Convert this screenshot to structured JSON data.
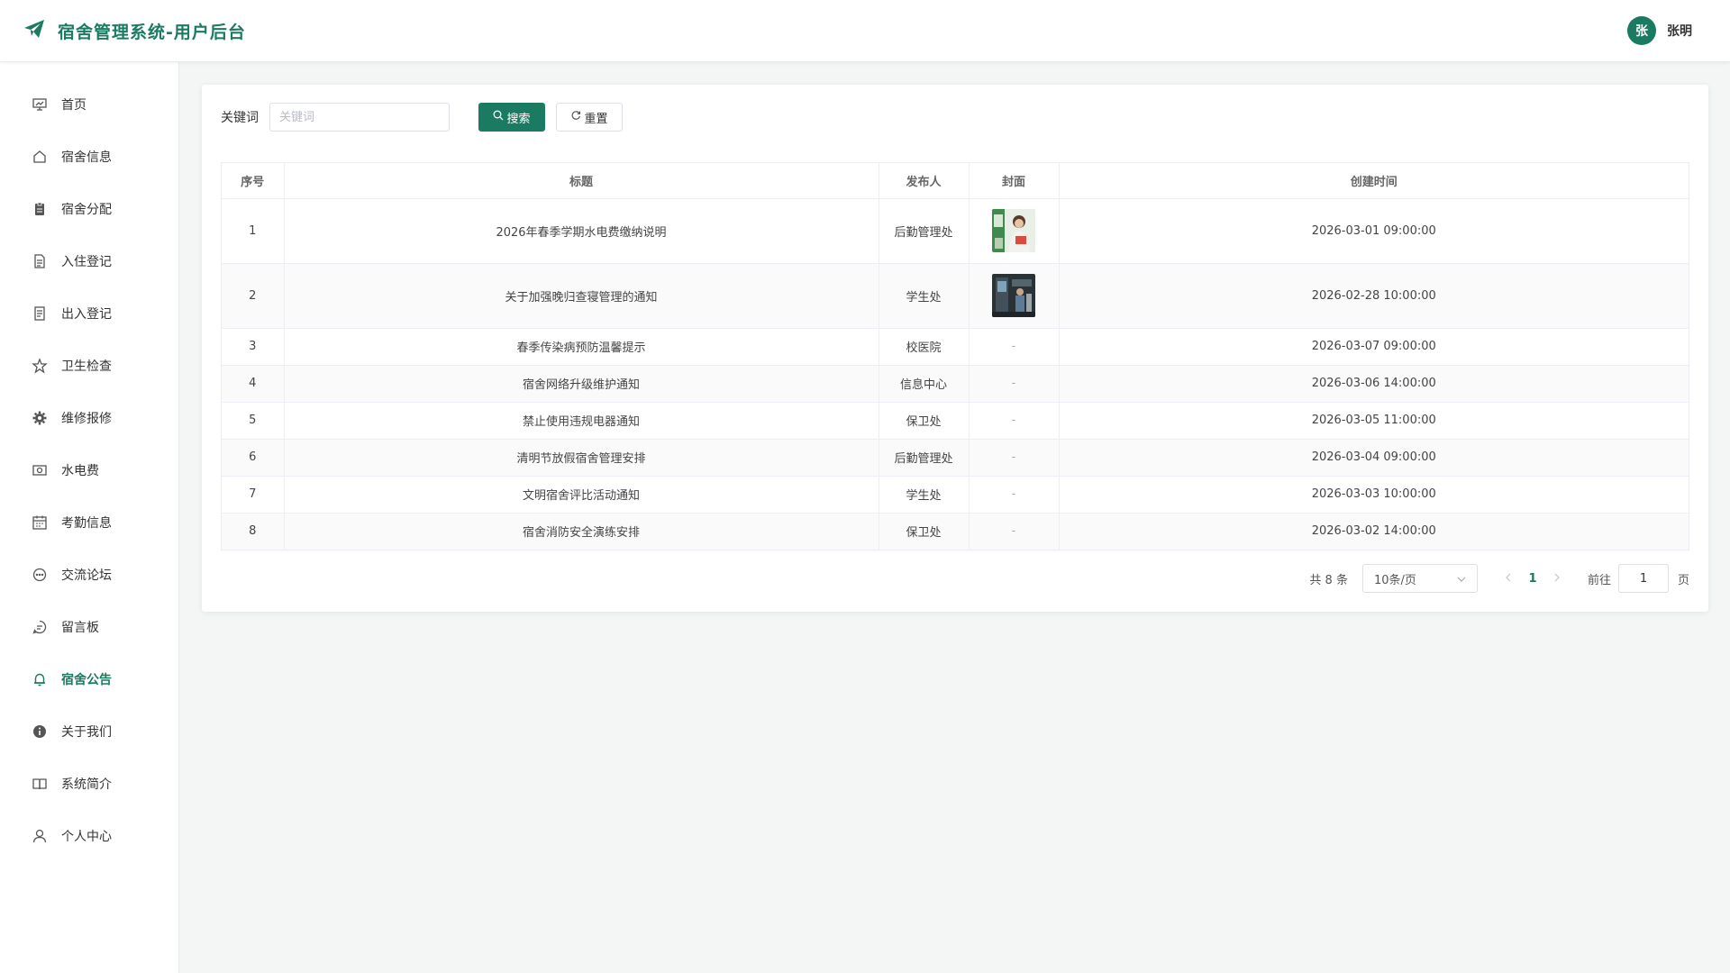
{
  "header": {
    "title": "宿舍管理系统-用户后台",
    "avatar_text": "张",
    "username": "张明",
    "accent": "#1a7a62"
  },
  "sidebar": {
    "items": [
      {
        "label": "首页",
        "icon": "dashboard-icon"
      },
      {
        "label": "宿舍信息",
        "icon": "home-icon"
      },
      {
        "label": "宿舍分配",
        "icon": "clipboard-icon"
      },
      {
        "label": "入住登记",
        "icon": "document-icon"
      },
      {
        "label": "出入登记",
        "icon": "tickets-icon"
      },
      {
        "label": "卫生检查",
        "icon": "star-icon"
      },
      {
        "label": "维修报修",
        "icon": "gear-icon"
      },
      {
        "label": "水电费",
        "icon": "money-icon"
      },
      {
        "label": "考勤信息",
        "icon": "calendar-icon"
      },
      {
        "label": "交流论坛",
        "icon": "chat-icon"
      },
      {
        "label": "留言板",
        "icon": "message-icon"
      },
      {
        "label": "宿舍公告",
        "icon": "bell-icon",
        "active": true
      },
      {
        "label": "关于我们",
        "icon": "info-icon"
      },
      {
        "label": "系统简介",
        "icon": "book-icon"
      },
      {
        "label": "个人中心",
        "icon": "user-icon"
      }
    ]
  },
  "search": {
    "label": "关键词",
    "placeholder": "关键词",
    "value": "",
    "search_label": "搜索",
    "reset_label": "重置"
  },
  "table": {
    "columns": [
      "序号",
      "标题",
      "发布人",
      "封面",
      "创建时间"
    ],
    "rows": [
      {
        "index": "1",
        "title": "2026年春季学期水电费缴纳说明",
        "publisher": "后勤管理处",
        "cover": "image",
        "created": "2026-03-01 09:00:00"
      },
      {
        "index": "2",
        "title": "关于加强晚归查寝管理的通知",
        "publisher": "学生处",
        "cover": "image",
        "created": "2026-02-28 10:00:00"
      },
      {
        "index": "3",
        "title": "春季传染病预防温馨提示",
        "publisher": "校医院",
        "cover": "-",
        "created": "2026-03-07 09:00:00"
      },
      {
        "index": "4",
        "title": "宿舍网络升级维护通知",
        "publisher": "信息中心",
        "cover": "-",
        "created": "2026-03-06 14:00:00"
      },
      {
        "index": "5",
        "title": "禁止使用违规电器通知",
        "publisher": "保卫处",
        "cover": "-",
        "created": "2026-03-05 11:00:00"
      },
      {
        "index": "6",
        "title": "清明节放假宿舍管理安排",
        "publisher": "后勤管理处",
        "cover": "-",
        "created": "2026-03-04 09:00:00"
      },
      {
        "index": "7",
        "title": "文明宿舍评比活动通知",
        "publisher": "学生处",
        "cover": "-",
        "created": "2026-03-03 10:00:00"
      },
      {
        "index": "8",
        "title": "宿舍消防安全演练安排",
        "publisher": "保卫处",
        "cover": "-",
        "created": "2026-03-02 14:00:00"
      }
    ]
  },
  "pager": {
    "total": "共 8 条",
    "page_size": "10条/页",
    "current": "1",
    "goto_label": "前往",
    "goto_value": "1",
    "unit": "页"
  }
}
